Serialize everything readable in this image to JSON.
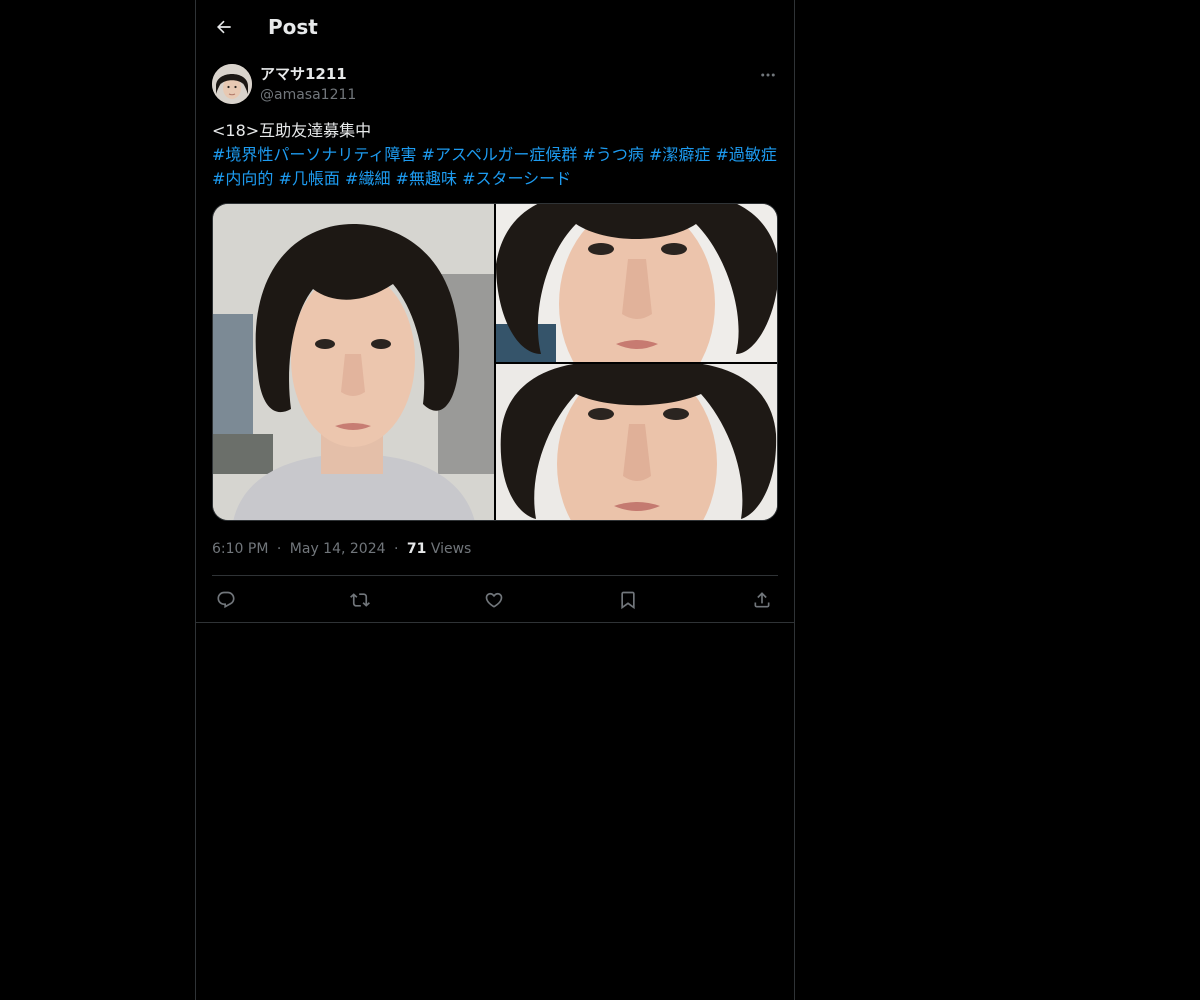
{
  "header": {
    "title": "Post"
  },
  "author": {
    "name": "アマサ1211",
    "handle": "@amasa1211"
  },
  "post": {
    "text": "<18>互助友達募集中",
    "hashtags": [
      "#境界性パーソナリティ障害",
      "#アスペルガー症候群",
      "#うつ病",
      "#潔癖症",
      "#過敏症",
      "#内向的",
      "#几帳面",
      "#繊細",
      "#無趣味",
      "#スターシード"
    ]
  },
  "media": {
    "photo_count": 3
  },
  "meta": {
    "time": "6:10 PM",
    "date": "May 14, 2024",
    "views_count": "71",
    "views_label": "Views",
    "separator": "·"
  },
  "icons": {
    "back": "arrow-left-icon",
    "more": "more-horizontal-icon",
    "reply": "reply-icon",
    "repost": "repost-icon",
    "like": "heart-icon",
    "bookmark": "bookmark-icon",
    "share": "share-icon"
  },
  "colors": {
    "background": "#000000",
    "text": "#e7e9ea",
    "secondary": "#71767b",
    "link": "#1d9bf0",
    "border": "#2f3336"
  }
}
